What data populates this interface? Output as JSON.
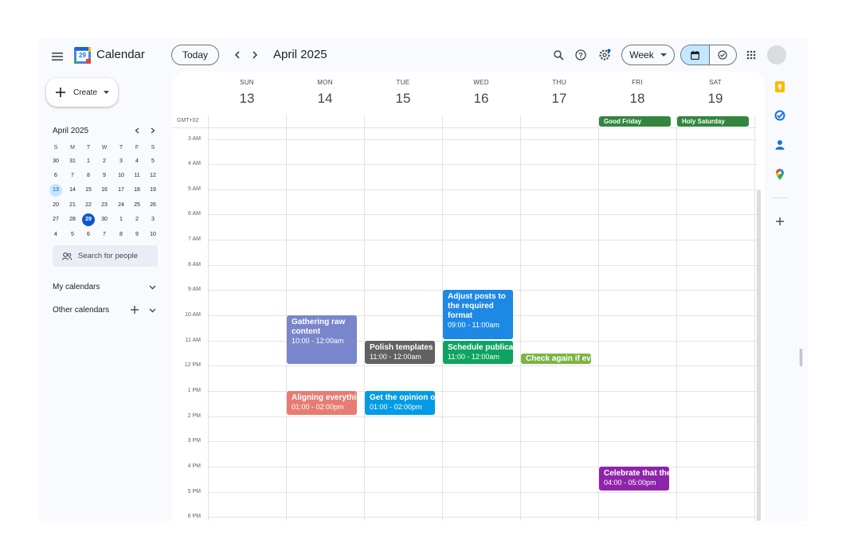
{
  "app": {
    "title": "Calendar",
    "logo_number": "29"
  },
  "toolbar": {
    "today_label": "Today",
    "period_label": "April 2025",
    "view_label": "Week",
    "brand_color": "#0b57d0"
  },
  "sidebar": {
    "create_label": "Create",
    "mini_calendar": {
      "month_label": "April 2025",
      "weekdays": [
        "S",
        "M",
        "T",
        "W",
        "T",
        "F",
        "S"
      ],
      "weeks": [
        [
          "30",
          "31",
          "1",
          "2",
          "3",
          "4",
          "5"
        ],
        [
          "6",
          "7",
          "8",
          "9",
          "10",
          "11",
          "12"
        ],
        [
          "13",
          "14",
          "15",
          "16",
          "17",
          "18",
          "19"
        ],
        [
          "20",
          "21",
          "22",
          "23",
          "24",
          "25",
          "26"
        ],
        [
          "27",
          "28",
          "29",
          "30",
          "1",
          "2",
          "3"
        ],
        [
          "4",
          "5",
          "6",
          "7",
          "8",
          "9",
          "10"
        ]
      ],
      "today": "29",
      "selected_week_start": "13"
    },
    "search_people_placeholder": "Search for people",
    "my_calendars_label": "My calendars",
    "other_calendars_label": "Other calendars"
  },
  "week": {
    "timezone_label": "GMT+02",
    "days": [
      {
        "name": "SUN",
        "num": "13"
      },
      {
        "name": "MON",
        "num": "14"
      },
      {
        "name": "TUE",
        "num": "15"
      },
      {
        "name": "WED",
        "num": "16"
      },
      {
        "name": "THU",
        "num": "17"
      },
      {
        "name": "FRI",
        "num": "18"
      },
      {
        "name": "SAT",
        "num": "19"
      }
    ],
    "all_day_events": [
      {
        "title": "Good Friday",
        "day": 5,
        "color": "#33853f"
      },
      {
        "title": "Holy Saturday",
        "day": 6,
        "color": "#33853f"
      }
    ],
    "hours": [
      "3 AM",
      "4 AM",
      "5 AM",
      "6 AM",
      "7 AM",
      "8 AM",
      "9 AM",
      "10 AM",
      "11 AM",
      "12 PM",
      "1 PM",
      "2 PM",
      "3 PM",
      "4 PM",
      "5 PM",
      "6 PM"
    ],
    "events": [
      {
        "title": "Gathering raw content",
        "time": "10:00 - 12:00am",
        "day": 1,
        "start": 10,
        "end": 12,
        "color": "#7986cb"
      },
      {
        "title": "Aligning everything",
        "time": "01:00 - 02:00pm",
        "day": 1,
        "start": 13,
        "end": 14,
        "color": "#e67c73"
      },
      {
        "title": "Polish templates",
        "time": "11:00 - 12:00am",
        "day": 2,
        "start": 11,
        "end": 12,
        "color": "#616161"
      },
      {
        "title": "Get the opinion of",
        "time": "01:00 - 02:00pm",
        "day": 2,
        "start": 13,
        "end": 14,
        "color": "#039be5"
      },
      {
        "title": "Adjust posts to the required format",
        "time": "09:00 - 11:00am",
        "day": 3,
        "start": 9,
        "end": 11,
        "color": "#1e88e5"
      },
      {
        "title": "Schedule publication",
        "time": "11:00 - 12:00am",
        "day": 3,
        "start": 11,
        "end": 12,
        "color": "#0fa361"
      },
      {
        "title": "Check again if everything",
        "time": "",
        "day": 4,
        "start": 11.5,
        "end": 12,
        "color": "#7cb342"
      },
      {
        "title": "Celebrate that the",
        "time": "04:00 - 05:00pm",
        "day": 5,
        "start": 16,
        "end": 17,
        "color": "#8e24aa"
      }
    ]
  }
}
